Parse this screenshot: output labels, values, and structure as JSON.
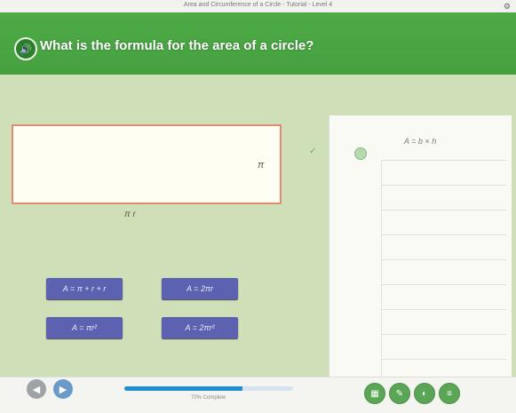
{
  "window": {
    "title": "Area and Circumference of a Circle - Tutorial - Level 4",
    "corner_icon": "settings-icon"
  },
  "header": {
    "audio_icon": "speaker-icon",
    "question": "What is the formula for the area of a circle?"
  },
  "workspace": {
    "answer_box_value": "",
    "loose_symbols": [
      "π",
      "✓",
      "π r"
    ]
  },
  "choices": [
    {
      "label": "A = π + r + r"
    },
    {
      "label": "A = 2πr"
    },
    {
      "label": "A = πr²"
    },
    {
      "label": "A = 2πr²"
    }
  ],
  "side_panel": {
    "formula": "A = b × h"
  },
  "footer": {
    "back_icon": "back-icon",
    "next_icon": "next-icon",
    "progress_percent": 70,
    "progress_label": "70% Complete",
    "tools": [
      {
        "icon": "calculator-icon"
      },
      {
        "icon": "pencil-icon"
      },
      {
        "icon": "eraser-icon"
      },
      {
        "icon": "notes-icon"
      }
    ]
  }
}
